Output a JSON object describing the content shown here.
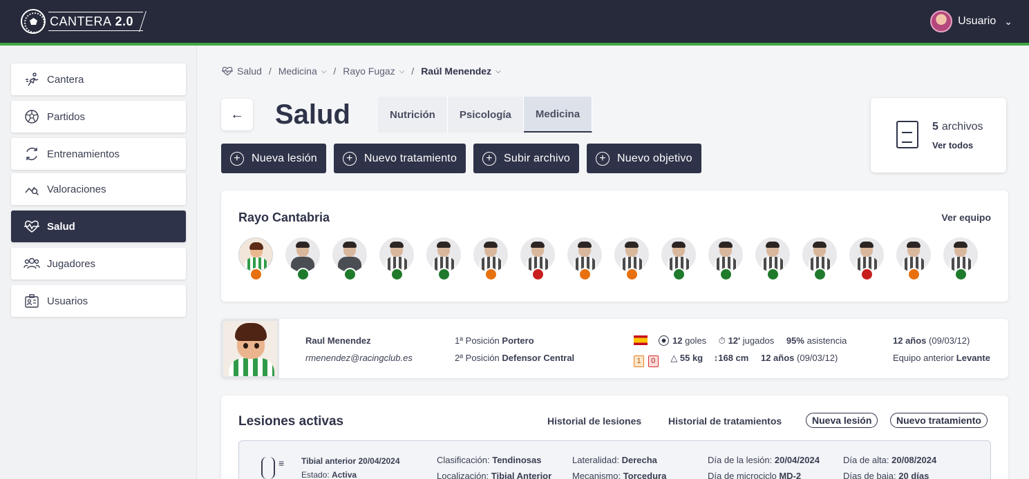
{
  "app": {
    "logo_text": "CANTERA",
    "logo_version": "2.0"
  },
  "user": {
    "name": "Usuario"
  },
  "sidebar": {
    "items": [
      {
        "label": "Cantera",
        "icon": "runner-icon"
      },
      {
        "label": "Partidos",
        "icon": "soccer-ball-icon"
      },
      {
        "label": "Entrenamientos",
        "icon": "refresh-icon"
      },
      {
        "label": "Valoraciones",
        "icon": "chart-search-icon"
      },
      {
        "label": "Salud",
        "icon": "heartbeat-icon",
        "active": true
      },
      {
        "label": "Jugadores",
        "icon": "users-icon"
      },
      {
        "label": "Usuarios",
        "icon": "id-card-icon"
      }
    ]
  },
  "breadcrumb": {
    "root": "Salud",
    "level1": "Medicina",
    "level2": "Rayo Fugaz",
    "current": "Raúl Menendez"
  },
  "page": {
    "title": "Salud"
  },
  "tabs": [
    {
      "label": "Nutrición"
    },
    {
      "label": "Psicología"
    },
    {
      "label": "Medicina",
      "active": true
    }
  ],
  "actions": [
    {
      "label": "Nueva lesión"
    },
    {
      "label": "Nuevo tratamiento"
    },
    {
      "label": "Subir archivo"
    },
    {
      "label": "Nuevo objetivo"
    }
  ],
  "files": {
    "count": "5",
    "label": "archivos",
    "link": "Ver todos"
  },
  "team": {
    "name": "Rayo Cantabria",
    "link": "Ver equipo",
    "status_colors": {
      "green": "#1f7a2c",
      "orange": "#e8710f",
      "red": "#c81e1e"
    },
    "players": [
      {
        "status": "orange"
      },
      {
        "status": "green"
      },
      {
        "status": "green"
      },
      {
        "status": "green"
      },
      {
        "status": "green"
      },
      {
        "status": "orange"
      },
      {
        "status": "red"
      },
      {
        "status": "orange"
      },
      {
        "status": "orange"
      },
      {
        "status": "green"
      },
      {
        "status": "green"
      },
      {
        "status": "green"
      },
      {
        "status": "green"
      },
      {
        "status": "red"
      },
      {
        "status": "orange"
      },
      {
        "status": "green"
      }
    ]
  },
  "player": {
    "name": "Raul Menendez",
    "email": "rmenendez@racingclub.es",
    "pos1_label": "1ª Posición",
    "pos1_value": "Portero",
    "pos2_label": "2ª Posición",
    "pos2_value": "Defensor Central",
    "goals_value": "12",
    "goals_label": "goles",
    "played_value": "12'",
    "played_label": "jugados",
    "attendance_value": "95%",
    "attendance_label": "asistencia",
    "yellow_cards": "1",
    "red_cards": "0",
    "weight": "55 kg",
    "height": "168 cm",
    "age_value": "12 años",
    "age_date": "(09/03/12)",
    "age_value_2": "12 años",
    "age_date_2": "(09/03/12)",
    "prev_team_label": "Equipo anterior",
    "prev_team_value": "Levante"
  },
  "injuries": {
    "title": "Lesiones activas",
    "history_link": "Historial de lesiones",
    "treatments_link": "Historial de tratamientos",
    "new_injury": "Nueva lesión",
    "new_treatment": "Nuevo tratamiento",
    "row": {
      "name": "Tibial anterior 20/04/2024",
      "state_label": "Estado:",
      "state_value": "Activa",
      "class_label": "Clasificación:",
      "class_value": "Tendinosas",
      "loc_label": "Localización:",
      "loc_value": "Tibial Anterior",
      "lat_label": "Lateralidad:",
      "lat_value": "Derecha",
      "mech_label": "Mecanismo:",
      "mech_value": "Torcedura",
      "inj_day_label": "Día de la lesión:",
      "inj_day_value": "20/04/2024",
      "micro_label": "Día de microciclo",
      "micro_value": "MD-2",
      "discharge_label": "Día de alta:",
      "discharge_value": "20/08/2024",
      "leave_label": "Días de baja:",
      "leave_value": "20 días"
    }
  }
}
